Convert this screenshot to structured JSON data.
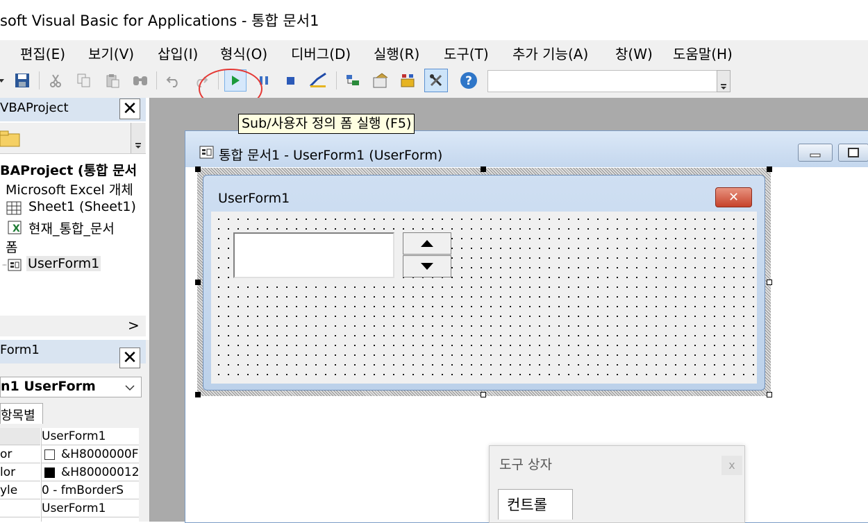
{
  "window": {
    "title": "soft Visual Basic for Applications - 통합 문서1"
  },
  "menu": [
    "편집(E)",
    "보기(V)",
    "삽입(I)",
    "형식(O)",
    "디버그(D)",
    "실행(R)",
    "도구(T)",
    "추가 기능(A)",
    "창(W)",
    "도움말(H)"
  ],
  "toolbar": {
    "buttons": [
      "save-icon",
      "cut-icon",
      "copy-icon",
      "paste-icon",
      "find-icon",
      "undo-icon",
      "redo-icon",
      "run-icon",
      "break-icon",
      "reset-icon",
      "design-mode-icon",
      "project-explorer-icon",
      "properties-icon",
      "object-browser-icon",
      "toolbox-icon",
      "help-icon"
    ],
    "tooltip": "Sub/사용자 정의 폼 실행 (F5)",
    "highlight_color": "#e53935"
  },
  "project": {
    "header": "VBAProject",
    "close": "✕",
    "tree": [
      "BAProject (통합 문서",
      "Microsoft Excel 개체",
      "Sheet1 (Sheet1)",
      "현재_통합_문서",
      "폼",
      "UserForm1"
    ],
    "scroll_right": ">"
  },
  "properties": {
    "header": "Form1",
    "close": "✕",
    "object_select": "n1 UserForm",
    "tab": "항목별",
    "rows": [
      {
        "name": "",
        "value": "UserForm1"
      },
      {
        "name": "or",
        "value": "&H8000000F"
      },
      {
        "name": "lor",
        "value": "&H80000012"
      },
      {
        "name": "yle",
        "value": "0 - fmBorderS"
      },
      {
        "name": "",
        "value": "UserForm1"
      }
    ]
  },
  "designer": {
    "title": "통합 문서1 - UserForm1 (UserForm)",
    "form_caption": "UserForm1",
    "form_close": "✕"
  },
  "toolbox": {
    "title": "도구 상자",
    "close": "x",
    "tab": "컨트롤"
  }
}
